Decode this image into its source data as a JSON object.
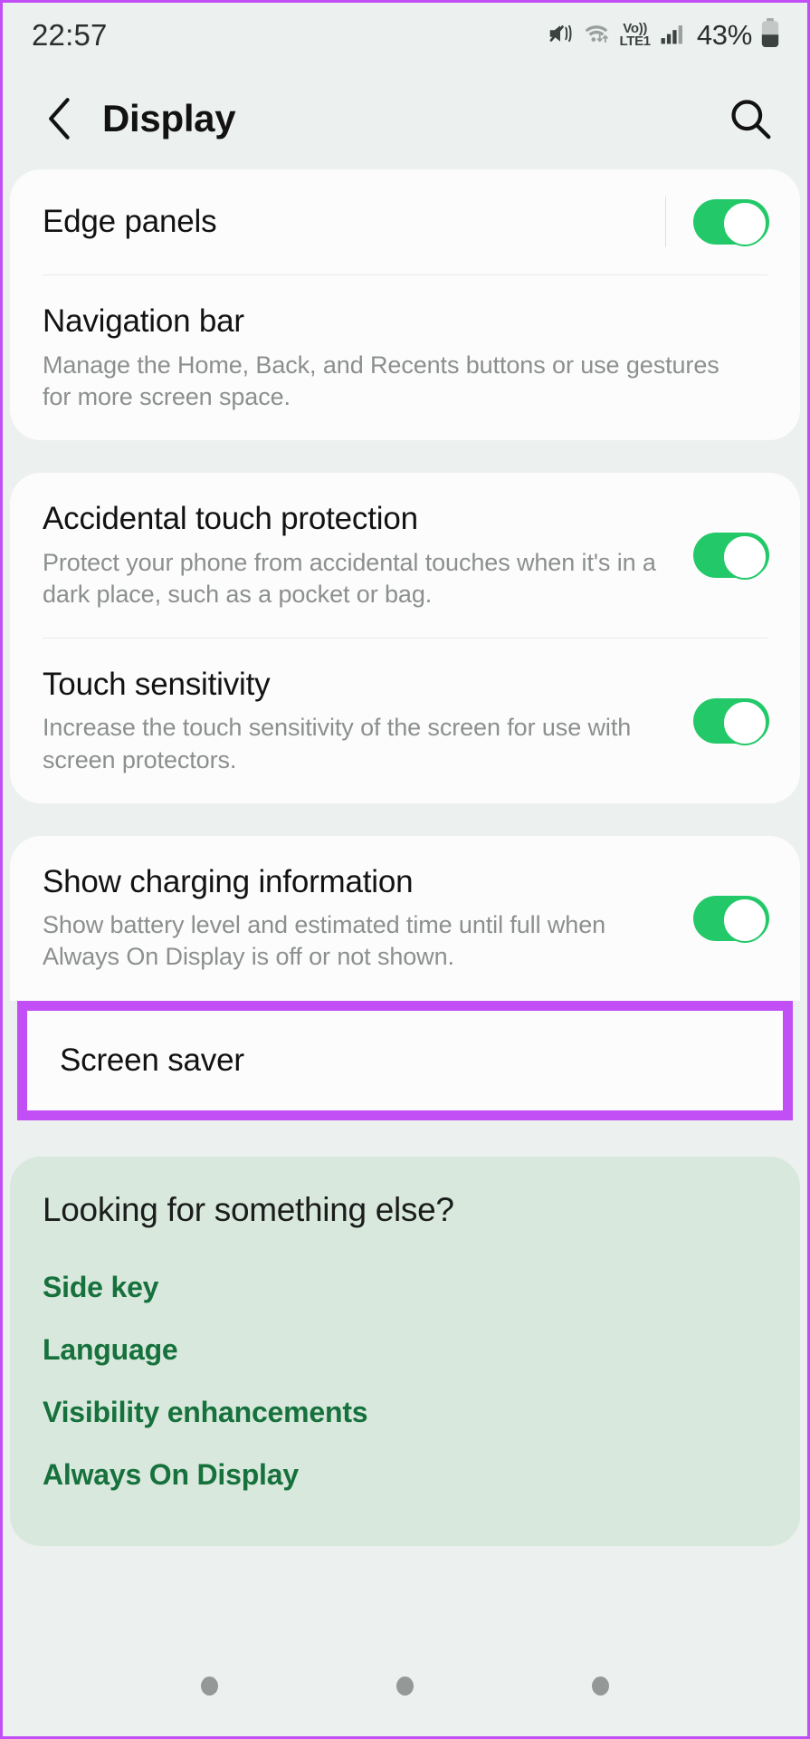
{
  "status_bar": {
    "time": "22:57",
    "battery_percent": "43%",
    "network_label_top": "Vo))",
    "network_label_bottom": "LTE1",
    "icons": [
      "mute-vibrate-icon",
      "wifi-icon",
      "volte-icon",
      "signal-bars-icon",
      "battery-icon"
    ]
  },
  "app_bar": {
    "title": "Display",
    "back_icon": "back-chevron-icon",
    "search_icon": "search-icon"
  },
  "groups": [
    {
      "rows": [
        {
          "title": "Edge panels",
          "desc": "",
          "toggle": true,
          "toggle_on": true,
          "divider_after": true
        },
        {
          "title": "Navigation bar",
          "desc": "Manage the Home, Back, and Recents buttons or use gestures for more screen space.",
          "toggle": false
        }
      ]
    },
    {
      "rows": [
        {
          "title": "Accidental touch protection",
          "desc": "Protect your phone from accidental touches when it's in a dark place, such as a pocket or bag.",
          "toggle": true,
          "toggle_on": true,
          "divider_after": true
        },
        {
          "title": "Touch sensitivity",
          "desc": "Increase the touch sensitivity of the screen for use with screen protectors.",
          "toggle": true,
          "toggle_on": true
        }
      ]
    },
    {
      "rows": [
        {
          "title": "Show charging information",
          "desc": "Show battery level and estimated time until full when Always On Display is off or not shown.",
          "toggle": true,
          "toggle_on": true
        }
      ]
    }
  ],
  "highlighted_row": {
    "title": "Screen saver",
    "highlight_color": "#c14ff5"
  },
  "suggestions": {
    "title": "Looking for something else?",
    "links": [
      "Side key",
      "Language",
      "Visibility enhancements",
      "Always On Display"
    ],
    "background": "#d8e8dc",
    "link_color": "#16713c"
  },
  "nav_bar": {
    "dots": [
      "recents-dot",
      "home-dot",
      "back-dot"
    ]
  },
  "colors": {
    "page_background": "#ecf0ef",
    "card_background": "#fcfcfc",
    "toggle_on": "#23c969",
    "title_text": "#121212",
    "desc_text": "#8b8f8e"
  }
}
